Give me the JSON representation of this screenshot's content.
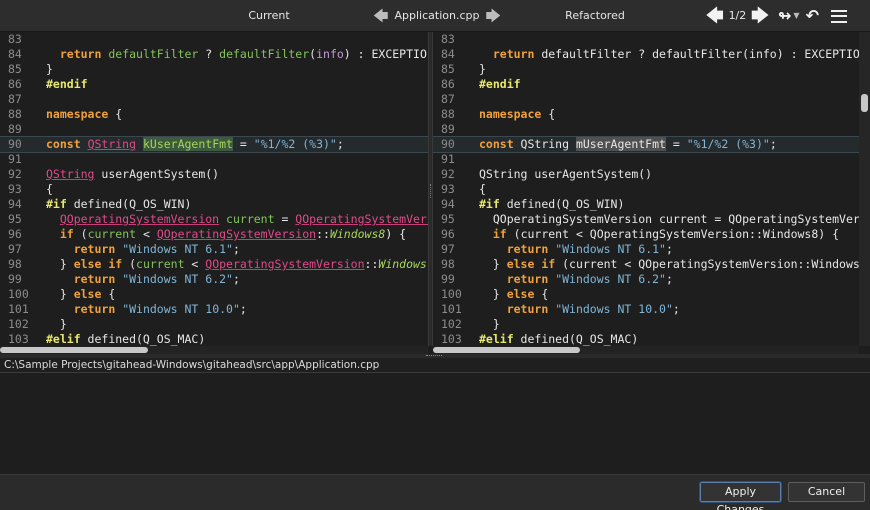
{
  "toolbar": {
    "left_label": "Current",
    "file_name": "Application.cpp",
    "right_label": "Refactored",
    "counter": "1/2"
  },
  "left_lines": [
    {
      "n": "83",
      "segs": []
    },
    {
      "n": "84",
      "segs": [
        {
          "t": "  "
        },
        {
          "t": "return",
          "c": "kw"
        },
        {
          "t": " "
        },
        {
          "t": "defaultFilter",
          "c": "fn"
        },
        {
          "t": " ? "
        },
        {
          "t": "defaultFilter",
          "c": "fn"
        },
        {
          "t": "("
        },
        {
          "t": "info",
          "c": "prm"
        },
        {
          "t": ") : EXCEPTIO"
        }
      ]
    },
    {
      "n": "85",
      "segs": [
        {
          "t": "}"
        }
      ]
    },
    {
      "n": "86",
      "segs": [
        {
          "t": "#endif",
          "c": "pp"
        }
      ]
    },
    {
      "n": "87",
      "segs": []
    },
    {
      "n": "88",
      "segs": [
        {
          "t": "namespace",
          "c": "kw"
        },
        {
          "t": " {"
        }
      ]
    },
    {
      "n": "89",
      "segs": []
    },
    {
      "n": "90",
      "hl": true,
      "segs": [
        {
          "t": "const",
          "c": "kw"
        },
        {
          "t": " "
        },
        {
          "t": "QString",
          "c": "ty"
        },
        {
          "t": " "
        },
        {
          "t": "kUserAgentFmt",
          "c": "cur-sel"
        },
        {
          "t": " = "
        },
        {
          "t": "\"%1/%2 (%3)\"",
          "c": "str"
        },
        {
          "t": ";"
        }
      ]
    },
    {
      "n": "91",
      "segs": []
    },
    {
      "n": "92",
      "segs": [
        {
          "t": "QString",
          "c": "ty"
        },
        {
          "t": " userAgentSystem()"
        }
      ]
    },
    {
      "n": "93",
      "segs": [
        {
          "t": "{"
        }
      ]
    },
    {
      "n": "94",
      "segs": [
        {
          "t": "#if",
          "c": "pp"
        },
        {
          "t": " defined(Q_OS_WIN)"
        }
      ]
    },
    {
      "n": "95",
      "segs": [
        {
          "t": "  "
        },
        {
          "t": "QOperatingSystemVersion",
          "c": "ty"
        },
        {
          "t": " "
        },
        {
          "t": "current",
          "c": "fn"
        },
        {
          "t": " = "
        },
        {
          "t": "QOperatingSystemVers",
          "c": "ty"
        }
      ]
    },
    {
      "n": "96",
      "segs": [
        {
          "t": "  "
        },
        {
          "t": "if",
          "c": "kw"
        },
        {
          "t": " ("
        },
        {
          "t": "current",
          "c": "fn"
        },
        {
          "t": " < "
        },
        {
          "t": "QOperatingSystemVersion",
          "c": "ty"
        },
        {
          "t": "::"
        },
        {
          "t": "Windows8",
          "c": "it"
        },
        {
          "t": ") {"
        }
      ]
    },
    {
      "n": "97",
      "segs": [
        {
          "t": "    "
        },
        {
          "t": "return",
          "c": "kw"
        },
        {
          "t": " "
        },
        {
          "t": "\"Windows NT 6.1\"",
          "c": "str"
        },
        {
          "t": ";"
        }
      ]
    },
    {
      "n": "98",
      "segs": [
        {
          "t": "  } "
        },
        {
          "t": "else if",
          "c": "kw"
        },
        {
          "t": " ("
        },
        {
          "t": "current",
          "c": "fn"
        },
        {
          "t": " < "
        },
        {
          "t": "QOperatingSystemVersion",
          "c": "ty"
        },
        {
          "t": "::"
        },
        {
          "t": "Windows",
          "c": "it"
        }
      ]
    },
    {
      "n": "99",
      "segs": [
        {
          "t": "    "
        },
        {
          "t": "return",
          "c": "kw"
        },
        {
          "t": " "
        },
        {
          "t": "\"Windows NT 6.2\"",
          "c": "str"
        },
        {
          "t": ";"
        }
      ]
    },
    {
      "n": "100",
      "segs": [
        {
          "t": "  } "
        },
        {
          "t": "else",
          "c": "kw"
        },
        {
          "t": " {"
        }
      ]
    },
    {
      "n": "101",
      "segs": [
        {
          "t": "    "
        },
        {
          "t": "return",
          "c": "kw"
        },
        {
          "t": " "
        },
        {
          "t": "\"Windows NT 10.0\"",
          "c": "str"
        },
        {
          "t": ";"
        }
      ]
    },
    {
      "n": "102",
      "segs": [
        {
          "t": "  }"
        }
      ]
    },
    {
      "n": "103",
      "segs": [
        {
          "t": "#elif",
          "c": "pp"
        },
        {
          "t": " defined(Q_OS_MAC)"
        }
      ]
    }
  ],
  "right_lines": [
    {
      "n": "83",
      "segs": []
    },
    {
      "n": "84",
      "segs": [
        {
          "t": "  "
        },
        {
          "t": "return",
          "c": "kw"
        },
        {
          "t": " defaultFilter ? defaultFilter(info) : EXCEPTIO"
        }
      ]
    },
    {
      "n": "85",
      "segs": [
        {
          "t": "}"
        }
      ]
    },
    {
      "n": "86",
      "segs": [
        {
          "t": "#endif",
          "c": "pp"
        }
      ]
    },
    {
      "n": "87",
      "segs": []
    },
    {
      "n": "88",
      "segs": [
        {
          "t": "namespace",
          "c": "kw"
        },
        {
          "t": " {"
        }
      ]
    },
    {
      "n": "89",
      "segs": []
    },
    {
      "n": "90",
      "hl": true,
      "segs": [
        {
          "t": "const",
          "c": "kw"
        },
        {
          "t": " QString "
        },
        {
          "t": "mUserAgentFmt",
          "c": "ref-sel"
        },
        {
          "t": " = "
        },
        {
          "t": "\"%1/%2 (%3)\"",
          "c": "str"
        },
        {
          "t": ";"
        }
      ]
    },
    {
      "n": "91",
      "segs": []
    },
    {
      "n": "92",
      "segs": [
        {
          "t": "QString userAgentSystem()"
        }
      ]
    },
    {
      "n": "93",
      "segs": [
        {
          "t": "{"
        }
      ]
    },
    {
      "n": "94",
      "segs": [
        {
          "t": "#if",
          "c": "pp"
        },
        {
          "t": " defined(Q_OS_WIN)"
        }
      ]
    },
    {
      "n": "95",
      "segs": [
        {
          "t": "  QOperatingSystemVersion current = QOperatingSystemVer"
        }
      ]
    },
    {
      "n": "96",
      "segs": [
        {
          "t": "  "
        },
        {
          "t": "if",
          "c": "kw"
        },
        {
          "t": " (current < QOperatingSystemVersion::Windows8) {"
        }
      ]
    },
    {
      "n": "97",
      "segs": [
        {
          "t": "    "
        },
        {
          "t": "return",
          "c": "kw"
        },
        {
          "t": " "
        },
        {
          "t": "\"Windows NT 6.1\"",
          "c": "str"
        },
        {
          "t": ";"
        }
      ]
    },
    {
      "n": "98",
      "segs": [
        {
          "t": "  } "
        },
        {
          "t": "else if",
          "c": "kw"
        },
        {
          "t": " (current < QOperatingSystemVersion::Windows"
        }
      ]
    },
    {
      "n": "99",
      "segs": [
        {
          "t": "    "
        },
        {
          "t": "return",
          "c": "kw"
        },
        {
          "t": " "
        },
        {
          "t": "\"Windows NT 6.2\"",
          "c": "str"
        },
        {
          "t": ";"
        }
      ]
    },
    {
      "n": "100",
      "segs": [
        {
          "t": "  } "
        },
        {
          "t": "else",
          "c": "kw"
        },
        {
          "t": " {"
        }
      ]
    },
    {
      "n": "101",
      "segs": [
        {
          "t": "    "
        },
        {
          "t": "return",
          "c": "kw"
        },
        {
          "t": " "
        },
        {
          "t": "\"Windows NT 10.0\"",
          "c": "str"
        },
        {
          "t": ";"
        }
      ]
    },
    {
      "n": "102",
      "segs": [
        {
          "t": "  }"
        }
      ]
    },
    {
      "n": "103",
      "segs": [
        {
          "t": "#elif",
          "c": "pp"
        },
        {
          "t": " defined(Q_OS_MAC)"
        }
      ]
    }
  ],
  "path": "C:\\Sample Projects\\gitahead-Windows\\gitahead\\src\\app\\Application.cpp",
  "buttons": {
    "apply": "Apply Changes",
    "cancel": "Cancel"
  },
  "icons": {
    "prev_file": "arrow-left-icon",
    "next_file": "arrow-right-icon",
    "prev_change": "arrow-left-bold-icon",
    "next_change": "arrow-right-bold-icon",
    "merge": "merge-arrows-icon",
    "undo": "undo-icon",
    "menu": "hamburger-menu-icon"
  }
}
